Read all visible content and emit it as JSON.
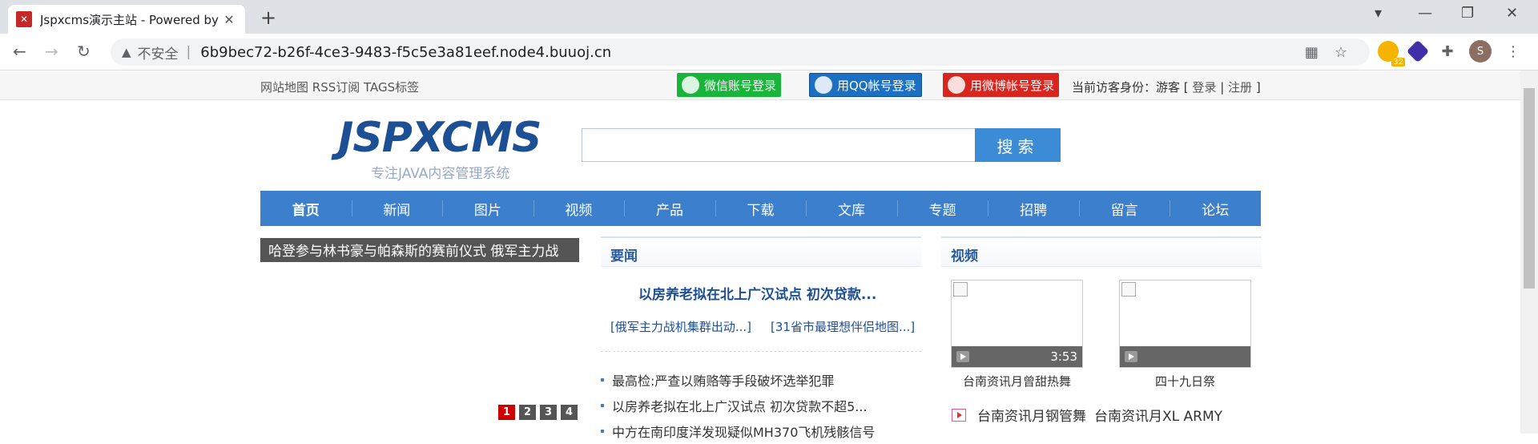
{
  "browser": {
    "tab_title": "Jspxcms演示主站 - Powered by",
    "tab_close": "✕",
    "new_tab": "+",
    "insecure_label": "不安全",
    "url": "6b9bec72-b26f-4ce3-9483-f5c5e3a81eef.node4.buuoj.cn",
    "extension_badge": "32",
    "profile_initial": "S"
  },
  "topbar": {
    "site_links": "网站地图 RSS订阅 TAGS标签",
    "wechat_login": "微信账号登录",
    "qq_login": "用QQ帐号登录",
    "weibo_login": "用微博帐号登录",
    "visitor_prefix": "当前访客身份：游客 [",
    "login": "登录",
    "register": "注册",
    "visitor_suffix": "]"
  },
  "header": {
    "logo": "JSPXCMS",
    "slogan": "专注JAVA内容管理系统",
    "search_button": "搜索"
  },
  "nav": [
    "首页",
    "新闻",
    "图片",
    "视频",
    "产品",
    "下载",
    "文库",
    "专题",
    "招聘",
    "留言",
    "论坛"
  ],
  "slider": {
    "caption": "哈登参与林书豪与帕森斯的赛前仪式   俄军主力战",
    "pages": [
      "1",
      "2",
      "3",
      "4"
    ]
  },
  "news": {
    "title": "要闻",
    "headline": "以房养老拟在北上广汉试点 初次贷款...",
    "sublinks": [
      "[俄军主力战机集群出动...]",
      "[31省市最理想伴侣地图...]"
    ],
    "items": [
      "最高检:严查以贿赂等手段破坏选举犯罪",
      "以房养老拟在北上广汉试点 初次贷款不超5...",
      "中方在南印度洋发现疑似MH370飞机残骸信号"
    ]
  },
  "video": {
    "title": "视频",
    "items": [
      {
        "duration": "3:53",
        "caption": "台南资讯月曾甜热舞"
      },
      {
        "duration": "",
        "caption": "四十九日祭"
      }
    ],
    "row": [
      "台南资讯月钢管舞",
      "台南资讯月XL ARMY"
    ]
  }
}
